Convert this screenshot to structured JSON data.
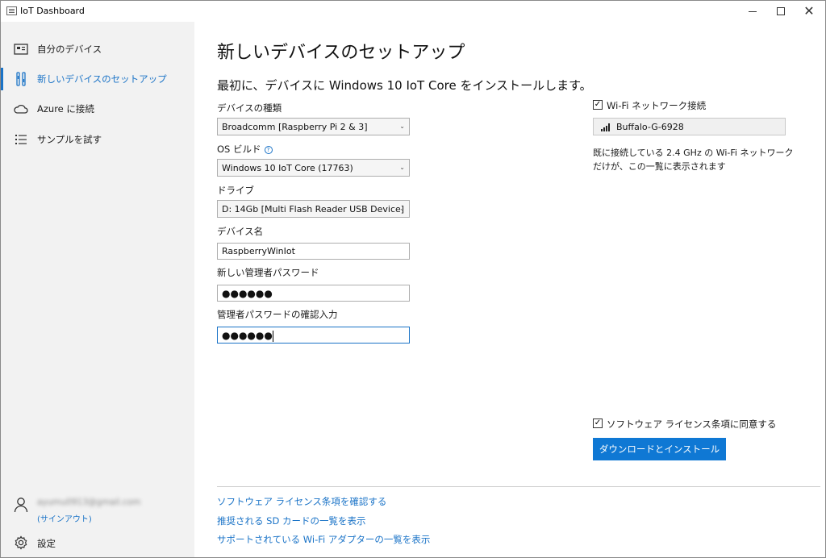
{
  "window": {
    "title": "IoT Dashboard"
  },
  "sidebar": {
    "items": [
      {
        "label": "自分のデバイス",
        "icon": "device-icon"
      },
      {
        "label": "新しいデバイスのセットアップ",
        "icon": "setup-icon",
        "active": true
      },
      {
        "label": "Azure に接続",
        "icon": "cloud-icon"
      },
      {
        "label": "サンプルを試す",
        "icon": "list-icon"
      }
    ],
    "account": {
      "email": "ayumu0913@gmail.com",
      "signout": "(サインアウト)"
    },
    "settings": {
      "label": "設定",
      "icon": "gear-icon"
    }
  },
  "main": {
    "title": "新しいデバイスのセットアップ",
    "subtitle": "最初に、デバイスに Windows 10 IoT Core をインストールします。",
    "device_type": {
      "label": "デバイスの種類",
      "value": "Broadcomm [Raspberry Pi 2 & 3]"
    },
    "os_build": {
      "label": "OS ビルド",
      "help": "?",
      "value": "Windows 10 IoT Core (17763)"
    },
    "drive": {
      "label": "ドライブ",
      "value": "D: 14Gb [Multi Flash Reader USB Device]"
    },
    "device_name": {
      "label": "デバイス名",
      "value": "RaspberryWinIot"
    },
    "admin_password": {
      "label": "新しい管理者パスワード",
      "value": "●●●●●●"
    },
    "confirm_password": {
      "label": "管理者パスワードの確認入力",
      "value": "●●●●●●"
    },
    "wifi": {
      "checkbox_label": "Wi-Fi ネットワーク接続",
      "checked": true,
      "network": "Buffalo-G-6928",
      "note": "既に接続している 2.4 GHz の Wi-Fi ネットワークだけが、この一覧に表示されます"
    },
    "license": {
      "checkbox_label": "ソフトウェア ライセンス条項に同意する",
      "checked": true
    },
    "install_button": "ダウンロードとインストール",
    "links": [
      "ソフトウェア ライセンス条項を確認する",
      "推奨される SD カードの一覧を表示",
      "サポートされている Wi-Fi アダプターの一覧を表示"
    ],
    "colors": {
      "accent": "#1a73c7",
      "button": "#0f78d4",
      "sidebar_bg": "#f2f2f2"
    }
  }
}
